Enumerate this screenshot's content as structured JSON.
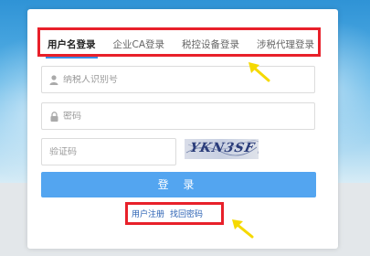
{
  "tabs": [
    {
      "label": "用户名登录",
      "active": true
    },
    {
      "label": "企业CA登录",
      "active": false
    },
    {
      "label": "税控设备登录",
      "active": false
    },
    {
      "label": "涉税代理登录",
      "active": false
    }
  ],
  "form": {
    "taxpayer_id_placeholder": "纳税人识别号",
    "password_placeholder": "密码",
    "captcha_placeholder": "验证码",
    "captcha_image_text": "YKN3SF"
  },
  "buttons": {
    "login_label": "登 录"
  },
  "links": {
    "register": "用户注册",
    "recover_password": "找回密码"
  },
  "colors": {
    "highlight": "#e8202a",
    "arrow": "#f5d900",
    "login_button": "#53a5f0",
    "link": "#2b62b4"
  }
}
